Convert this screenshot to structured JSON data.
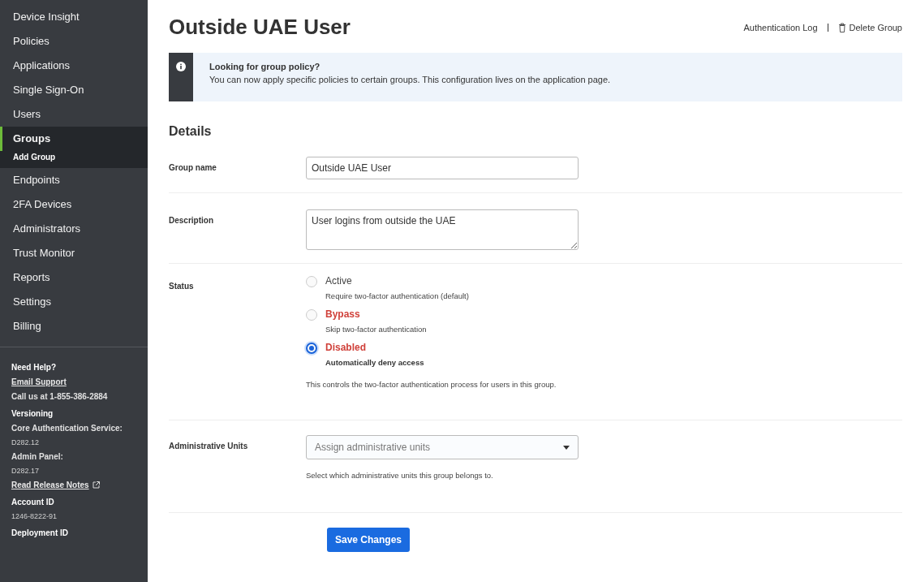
{
  "sidebar": {
    "items": [
      {
        "label": "Device Insight",
        "selected": false
      },
      {
        "label": "Policies",
        "selected": false
      },
      {
        "label": "Applications",
        "selected": false
      },
      {
        "label": "Single Sign-On",
        "selected": false
      },
      {
        "label": "Users",
        "selected": false
      },
      {
        "label": "Groups",
        "selected": true,
        "children": [
          {
            "label": "Add Group",
            "selected": false
          }
        ]
      },
      {
        "label": "Endpoints",
        "selected": false
      },
      {
        "label": "2FA Devices",
        "selected": false
      },
      {
        "label": "Administrators",
        "selected": false
      },
      {
        "label": "Trust Monitor",
        "selected": false
      },
      {
        "label": "Reports",
        "selected": false
      },
      {
        "label": "Settings",
        "selected": false
      },
      {
        "label": "Billing",
        "selected": false
      }
    ],
    "footer": [
      {
        "kind": "heading",
        "text": "Need Help?"
      },
      {
        "kind": "link",
        "text": "Email Support"
      },
      {
        "kind": "text",
        "text": "Call us at 1-855-386-2884"
      },
      {
        "kind": "heading",
        "text": "Versioning"
      },
      {
        "kind": "text",
        "text": "Core Authentication Service:"
      },
      {
        "kind": "small",
        "text": "D282.12"
      },
      {
        "kind": "text",
        "text": "Admin Panel:"
      },
      {
        "kind": "small",
        "text": "D282.17"
      },
      {
        "kind": "external",
        "text": "Read Release Notes"
      },
      {
        "kind": "heading",
        "text": "Account ID"
      },
      {
        "kind": "small",
        "text": "1246-8222-91"
      },
      {
        "kind": "heading",
        "text": "Deployment ID"
      }
    ]
  },
  "page": {
    "title": "Outside UAE User",
    "actions": [
      {
        "kind": "link",
        "label": "Authentication Log"
      },
      {
        "kind": "delete",
        "label": "Delete Group"
      }
    ]
  },
  "banner": {
    "title": "Looking for group policy?",
    "text": "You can now apply specific policies to certain groups. This configuration lives on the application page."
  },
  "details": {
    "heading": "Details",
    "group_name": {
      "label": "Group name",
      "value": "Outside UAE User"
    },
    "description": {
      "label": "Description",
      "value": "User logins from outside the UAE"
    },
    "status": {
      "label": "Status",
      "options": [
        {
          "label": "Active",
          "kind": "normal",
          "description": "Require two-factor authentication (default)",
          "selected": false
        },
        {
          "label": "Bypass",
          "kind": "danger",
          "description": "Skip two-factor authentication",
          "selected": false
        },
        {
          "label": "Disabled",
          "kind": "danger",
          "description": "Automatically deny access",
          "selected": true
        }
      ],
      "help": "This controls the two-factor authentication process for users in this group."
    },
    "admin_units": {
      "label": "Administrative Units",
      "placeholder": "Assign administrative units",
      "help": "Select which administrative units this group belongs to."
    }
  },
  "save_button": "Save Changes"
}
